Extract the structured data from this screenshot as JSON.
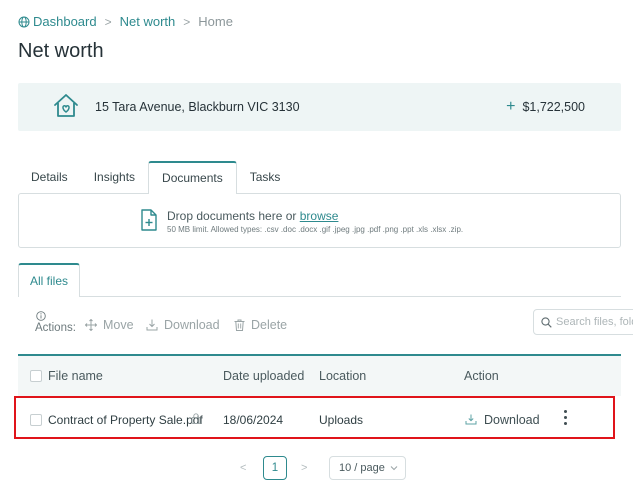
{
  "breadcrumb": {
    "items": [
      "Dashboard",
      "Net worth",
      "Home"
    ],
    "separator": ">"
  },
  "page_title": "Net worth",
  "property": {
    "address": "15 Tara Avenue, Blackburn VIC 3130",
    "value": "$1,722,500"
  },
  "tabs": [
    {
      "label": "Details",
      "active": false
    },
    {
      "label": "Insights",
      "active": false
    },
    {
      "label": "Documents",
      "active": true
    },
    {
      "label": "Tasks",
      "active": false
    }
  ],
  "dropzone": {
    "text": "Drop documents here or ",
    "link": "browse",
    "limits": "50 MB limit. Allowed types: .csv .doc .docx .gif .jpeg .jpg .pdf .png .ppt .xls .xlsx .zip."
  },
  "files_tab": "All files",
  "toolbar": {
    "actions_label": "Actions:",
    "move": "Move",
    "download": "Download",
    "delete": "Delete",
    "search_placeholder": "Search files, fold"
  },
  "table": {
    "columns": [
      "File name",
      "Date uploaded",
      "Location",
      "Action"
    ],
    "rows": [
      {
        "file_name": "Contract of Property Sale.pdf",
        "date_uploaded": "18/06/2024",
        "location": "Uploads",
        "action": "Download"
      }
    ]
  },
  "pagination": {
    "prev": "<",
    "current": "1",
    "next": ">",
    "page_size": "10 / page"
  },
  "colors": {
    "accent": "#2e8a8e",
    "highlight": "#e0141a",
    "banner_bg": "#eef5f5"
  }
}
